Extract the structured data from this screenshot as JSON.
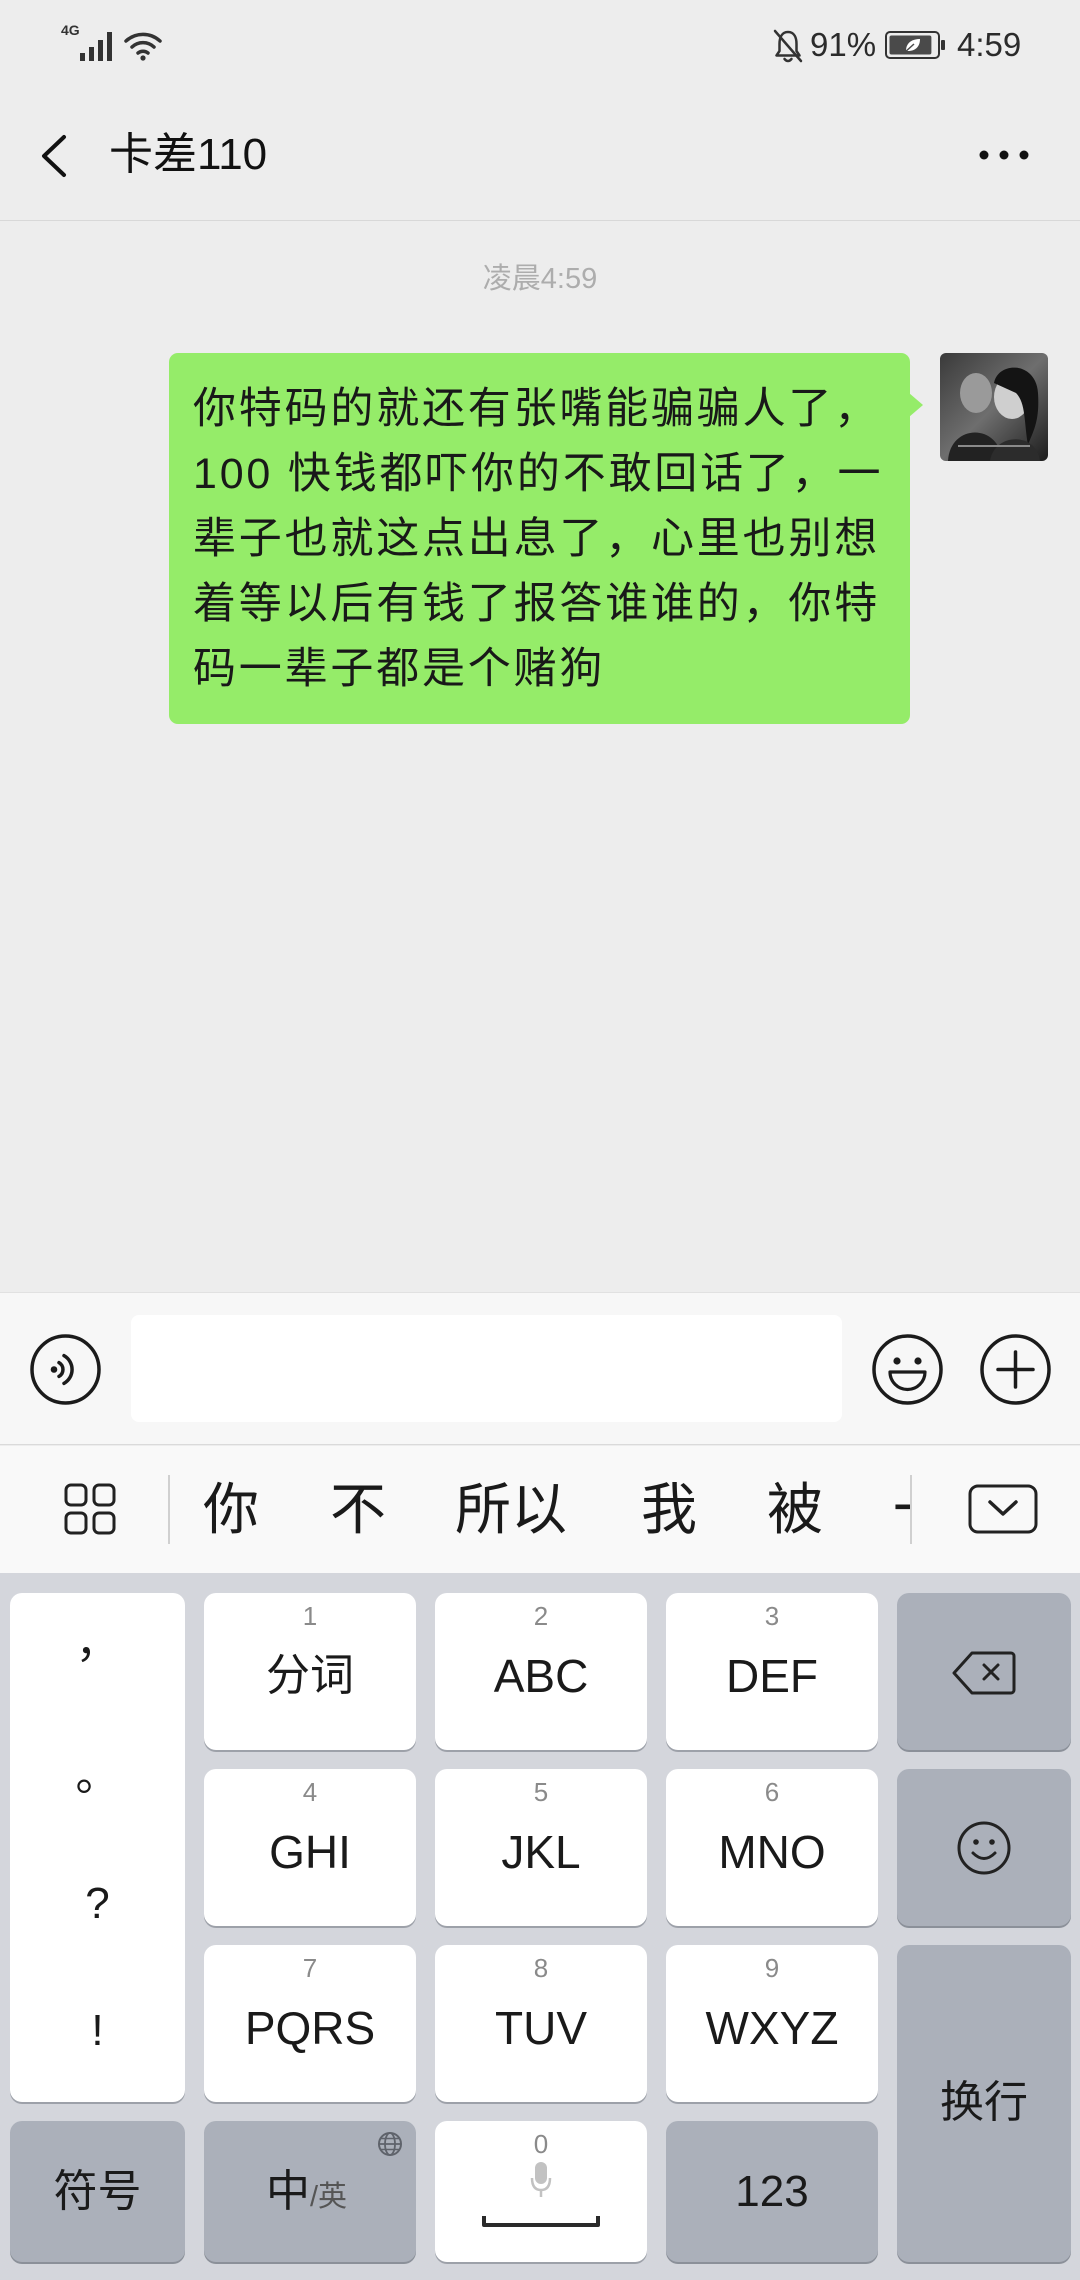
{
  "status_bar": {
    "network": "4G",
    "signal_icon": "signal-icon",
    "wifi_icon": "wifi-icon",
    "mute_icon": "bell-off-icon",
    "battery_percent": "91%",
    "battery_level": 0.91,
    "battery_icon": "battery-saver-icon",
    "time": "4:59"
  },
  "header": {
    "back_icon": "chevron-left-icon",
    "title": "卡差110",
    "more_icon": "more-icon"
  },
  "chat": {
    "timestamp": "凌晨4:59",
    "messages": [
      {
        "text": "你特码的就还有张嘴能骗骗人了，100 快钱都吓你的不敢回话了，一辈子也就这点出息了，心里也别想着等以后有钱了报答谁谁的，你特码一辈子都是个赌狗"
      }
    ]
  },
  "input_bar": {
    "voice_icon": "voice-icon",
    "value": "",
    "emoji_icon": "emoji-icon",
    "more_icon": "plus-icon"
  },
  "candidate_bar": {
    "menu_icon": "grid-icon",
    "candidates": [
      "你",
      "不",
      "所以",
      "我",
      "被",
      "一"
    ],
    "collapse_icon": "keyboard-collapse-icon"
  },
  "keyboard": {
    "punctuation": [
      "，",
      "。",
      "?",
      "!"
    ],
    "t9_keys": [
      {
        "num": "1",
        "label": "分词"
      },
      {
        "num": "2",
        "label": "ABC"
      },
      {
        "num": "3",
        "label": "DEF"
      },
      {
        "num": "4",
        "label": "GHI"
      },
      {
        "num": "5",
        "label": "JKL"
      },
      {
        "num": "6",
        "label": "MNO"
      },
      {
        "num": "7",
        "label": "PQRS"
      },
      {
        "num": "8",
        "label": "TUV"
      },
      {
        "num": "9",
        "label": "WXYZ"
      }
    ],
    "backspace_icon": "backspace-icon",
    "emoji_key_icon": "smiley-icon",
    "enter_label": "换行",
    "symbols_label": "符号",
    "lang_primary": "中",
    "lang_secondary": "/英",
    "globe_icon": "globe-icon",
    "space_num": "0",
    "mic_icon": "microphone-icon",
    "numbers_label": "123"
  },
  "colors": {
    "chat_bg": "#ededed",
    "outgoing_bubble": "#95ec69",
    "keyboard_bg": "#d4d6dc",
    "function_key": "#abb0ba",
    "character_key": "#ffffff"
  }
}
